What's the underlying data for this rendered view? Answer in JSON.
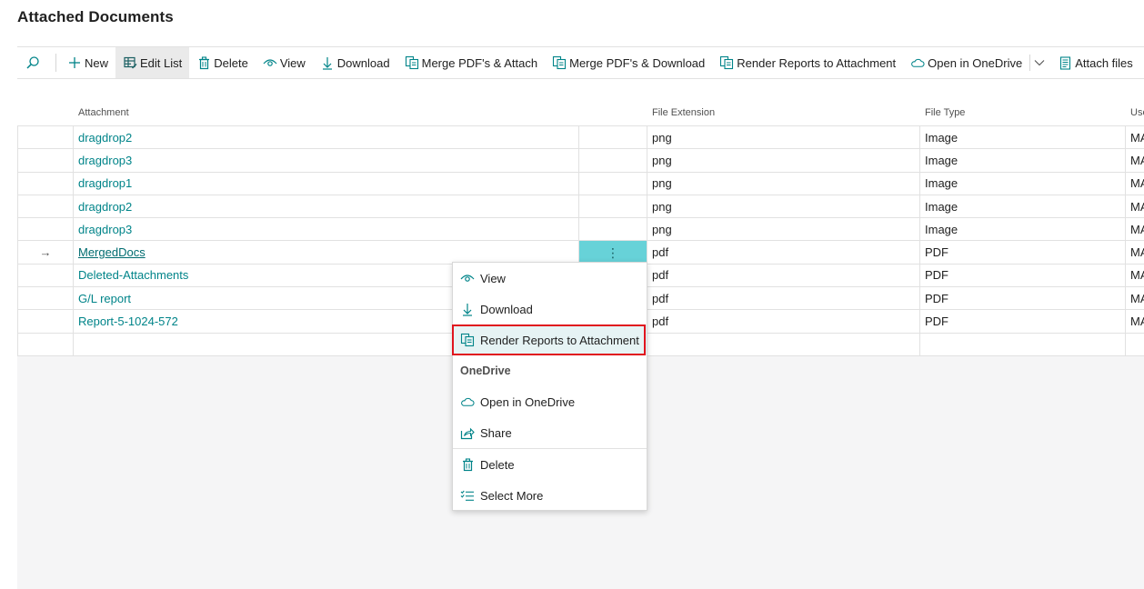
{
  "page": {
    "title": "Attached Documents"
  },
  "toolbar": {
    "new_label": "New",
    "edit_list_label": "Edit List",
    "delete_label": "Delete",
    "view_label": "View",
    "download_label": "Download",
    "merge_attach_label": "Merge PDF's & Attach",
    "merge_download_label": "Merge PDF's & Download",
    "render_reports_label": "Render Reports to Attachment",
    "open_onedrive_label": "Open in OneDrive",
    "attach_files_label": "Attach files"
  },
  "columns": {
    "attachment": "Attachment",
    "file_extension": "File Extension",
    "file_type": "File Type",
    "user": "Use"
  },
  "rows": [
    {
      "attachment": "dragdrop2",
      "ext": "png",
      "type": "Image",
      "user": "MA"
    },
    {
      "attachment": "dragdrop3",
      "ext": "png",
      "type": "Image",
      "user": "MA"
    },
    {
      "attachment": "dragdrop1",
      "ext": "png",
      "type": "Image",
      "user": "MA"
    },
    {
      "attachment": "dragdrop2",
      "ext": "png",
      "type": "Image",
      "user": "MA"
    },
    {
      "attachment": "dragdrop3",
      "ext": "png",
      "type": "Image",
      "user": "MA"
    },
    {
      "attachment": "MergedDocs",
      "ext": "pdf",
      "type": "PDF",
      "user": "MA",
      "current": true,
      "marker": "→",
      "menu": "⋮"
    },
    {
      "attachment": "Deleted-Attachments",
      "ext": "pdf",
      "type": "PDF",
      "user": "MA"
    },
    {
      "attachment": "G/L report",
      "ext": "pdf",
      "type": "PDF",
      "user": "MA"
    },
    {
      "attachment": "Report-5-1024-572",
      "ext": "pdf",
      "type": "PDF",
      "user": "MA"
    },
    {
      "attachment": "",
      "ext": "",
      "type": "",
      "user": ""
    }
  ],
  "context_menu": {
    "view": "View",
    "download": "Download",
    "render_reports": "Render Reports to Attachment",
    "onedrive_group": "OneDrive",
    "open_onedrive": "Open in OneDrive",
    "share": "Share",
    "delete": "Delete",
    "select_more": "Select More"
  },
  "colors": {
    "accent": "#008489",
    "current_menu_cell": "#67d2d8",
    "highlight_border": "#e0141e"
  }
}
